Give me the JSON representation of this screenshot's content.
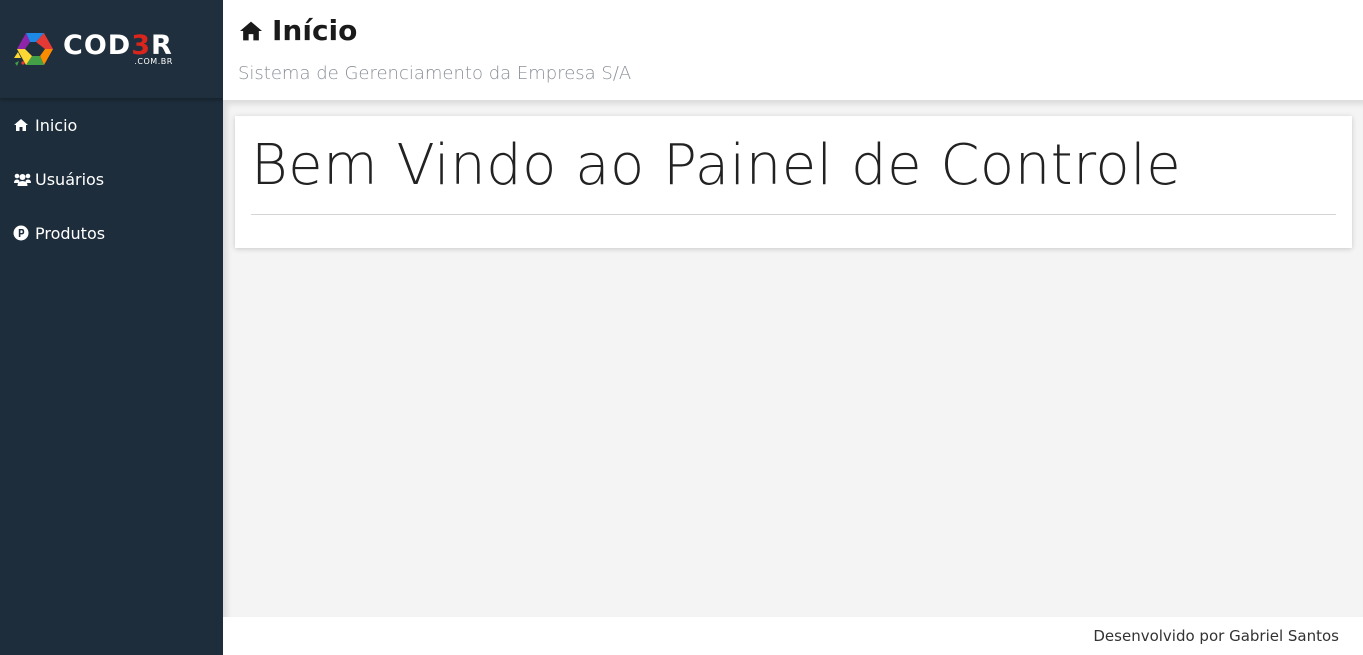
{
  "logo": {
    "word_white": "COD",
    "word_red": "3",
    "word_end": "R",
    "sub": ".COM.BR"
  },
  "sidebar": {
    "items": [
      {
        "label": "Inicio",
        "icon": "home-icon"
      },
      {
        "label": "Usuários",
        "icon": "users-icon"
      },
      {
        "label": "Produtos",
        "icon": "product-hunt-icon"
      }
    ]
  },
  "header": {
    "title": "Início",
    "title_icon": "home-icon",
    "subtitle": "Sistema de Gerenciamento da Empresa S/A"
  },
  "main": {
    "card_title": "Bem Vindo ao Painel de Controle"
  },
  "footer": {
    "text": "Desenvolvido por Gabriel Santos"
  },
  "colors": {
    "sidebar_bg": "#1d2d3b",
    "logo_accent": "#d9251c",
    "content_bg": "#f4f4f4"
  }
}
